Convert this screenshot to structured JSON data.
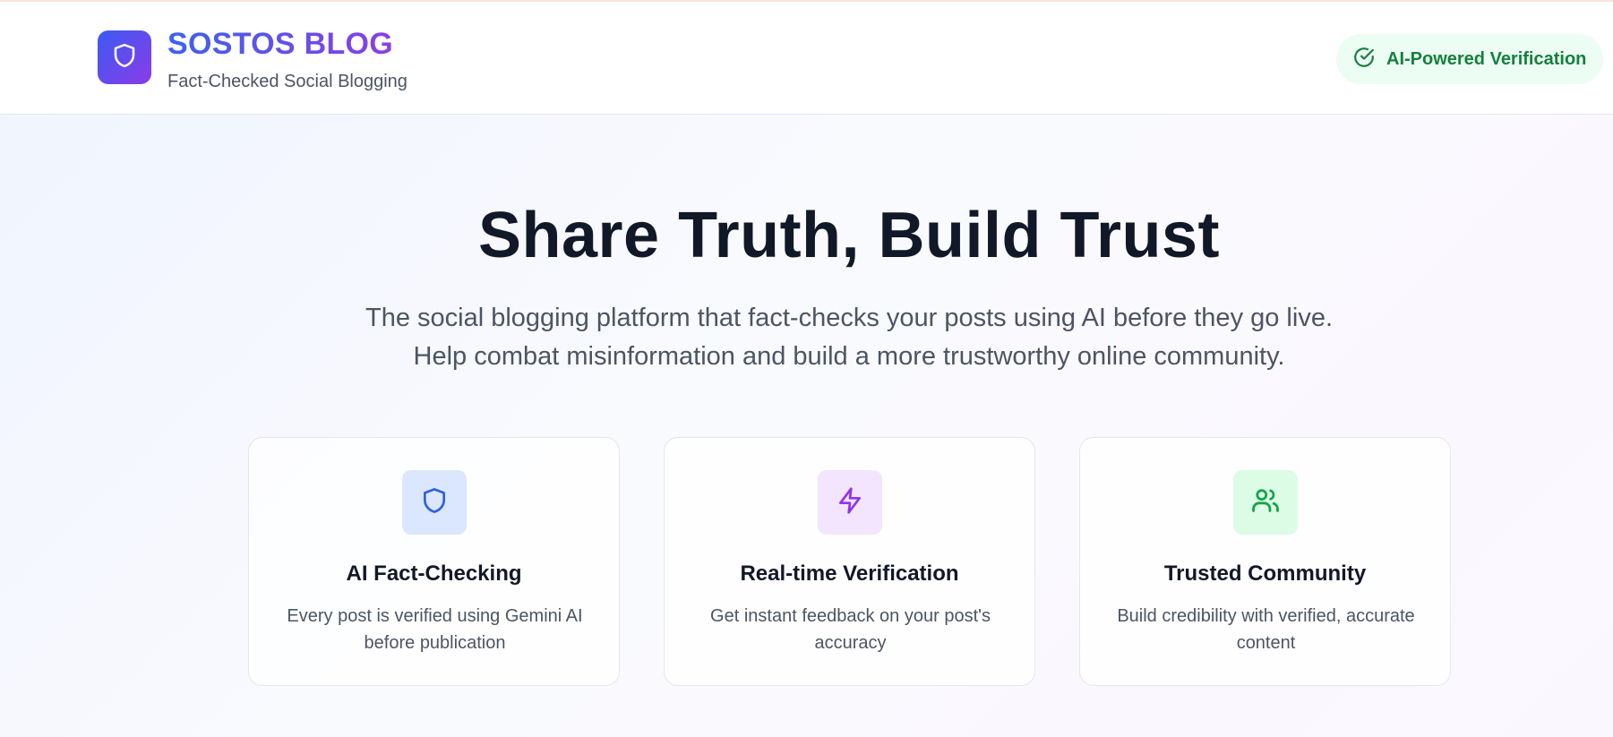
{
  "header": {
    "brand_title": "SOSTOS BLOG",
    "brand_subtitle": "Fact-Checked Social Blogging",
    "logo_icon": "shield-icon",
    "badge_label": "AI-Powered Verification",
    "badge_icon": "check-circle-icon"
  },
  "hero": {
    "title": "Share Truth, Build Trust",
    "lines": [
      "The social blogging platform that fact-checks your posts using AI before they go live.",
      "Help combat misinformation and build a more trustworthy online community."
    ]
  },
  "features": [
    {
      "icon": "shield-icon",
      "title": "AI Fact-Checking",
      "description": "Every post is verified using Gemini AI before publication"
    },
    {
      "icon": "lightning-icon",
      "title": "Real-time Verification",
      "description": "Get instant feedback on your post's accuracy"
    },
    {
      "icon": "users-icon",
      "title": "Trusted Community",
      "description": "Build credibility with verified, accurate content"
    }
  ],
  "colors": {
    "brand_gradient_start": "#3b5bf2",
    "brand_gradient_end": "#8b3be8",
    "verified_green": "#15803d",
    "blue_icon": "#2f5fe0",
    "purple_icon": "#9333ea",
    "green_icon": "#16a34a"
  }
}
